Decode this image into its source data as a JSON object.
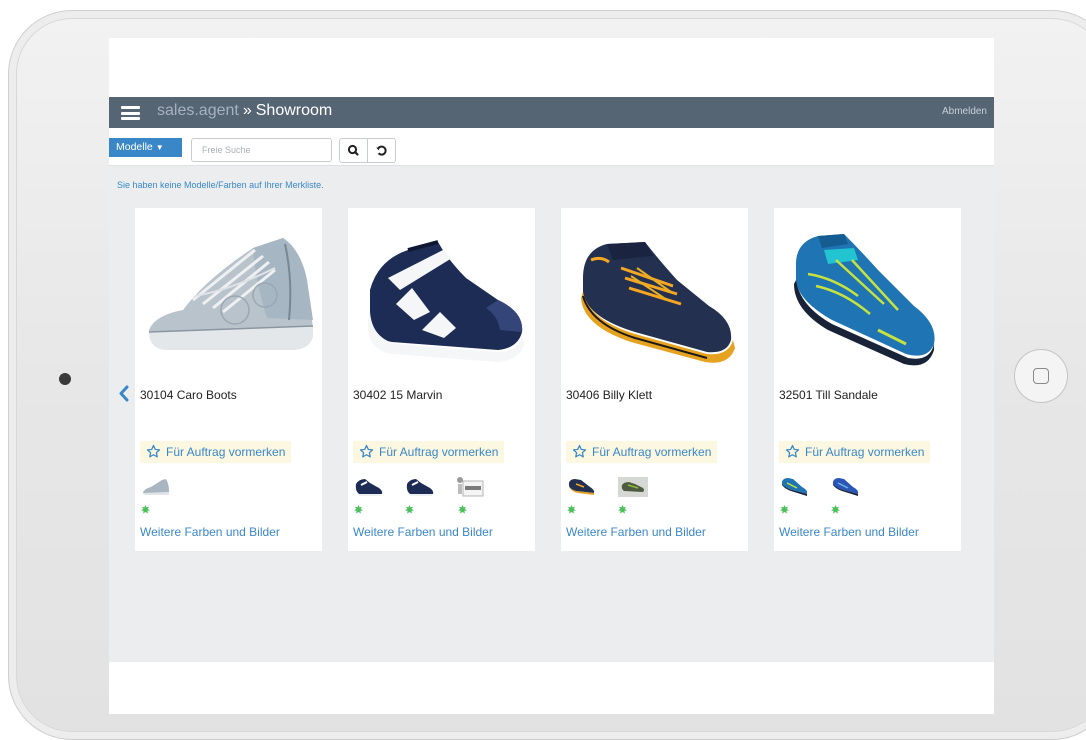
{
  "app": {
    "brand": "sales.agent",
    "separator": "»",
    "page": "Showroom",
    "logout_label": "Abmelden"
  },
  "toolbar": {
    "models_label": "Modelle",
    "search_placeholder": "Freie Suche",
    "search_value": ""
  },
  "info_text": "Sie haben keine Modelle/Farben auf Ihrer Merkliste.",
  "colors": {
    "navbar": "#566574",
    "accent": "#3a87c8",
    "status_green": "#4cc05a",
    "reserve_bg": "#fbf7e1"
  },
  "products": [
    {
      "title": "30104 Caro Boots",
      "reserve_label": "Für Auftrag vormerken",
      "more_label": "Weitere Farben und Bilder",
      "image_icon": "grey-high-top-sneaker-photo",
      "thumbnails": [
        "grey-boot-thumbnail"
      ]
    },
    {
      "title": "30402 15 Marvin",
      "reserve_label": "Für Auftrag vormerken",
      "more_label": "Weitere Farben und Bilder",
      "image_icon": "navy-white-sneaker-photo",
      "thumbnails": [
        "navy-sneaker-thumbnail",
        "navy-sneaker-thumbnail-2",
        "no-image-placeholder"
      ]
    },
    {
      "title": "30406 Billy Klett",
      "reserve_label": "Für Auftrag vormerken",
      "more_label": "Weitere Farben und Bilder",
      "image_icon": "navy-orange-velcro-sneaker-photo",
      "thumbnails": [
        "navy-orange-sneaker-thumbnail",
        "grey-green-sneaker-thumbnail"
      ]
    },
    {
      "title": "32501 Till Sandale",
      "reserve_label": "Für Auftrag vormerken",
      "more_label": "Weitere Farben und Bilder",
      "image_icon": "blue-sport-sandal-photo",
      "thumbnails": [
        "blue-sandal-thumbnail",
        "blue-sandal-thumbnail-2"
      ]
    }
  ]
}
